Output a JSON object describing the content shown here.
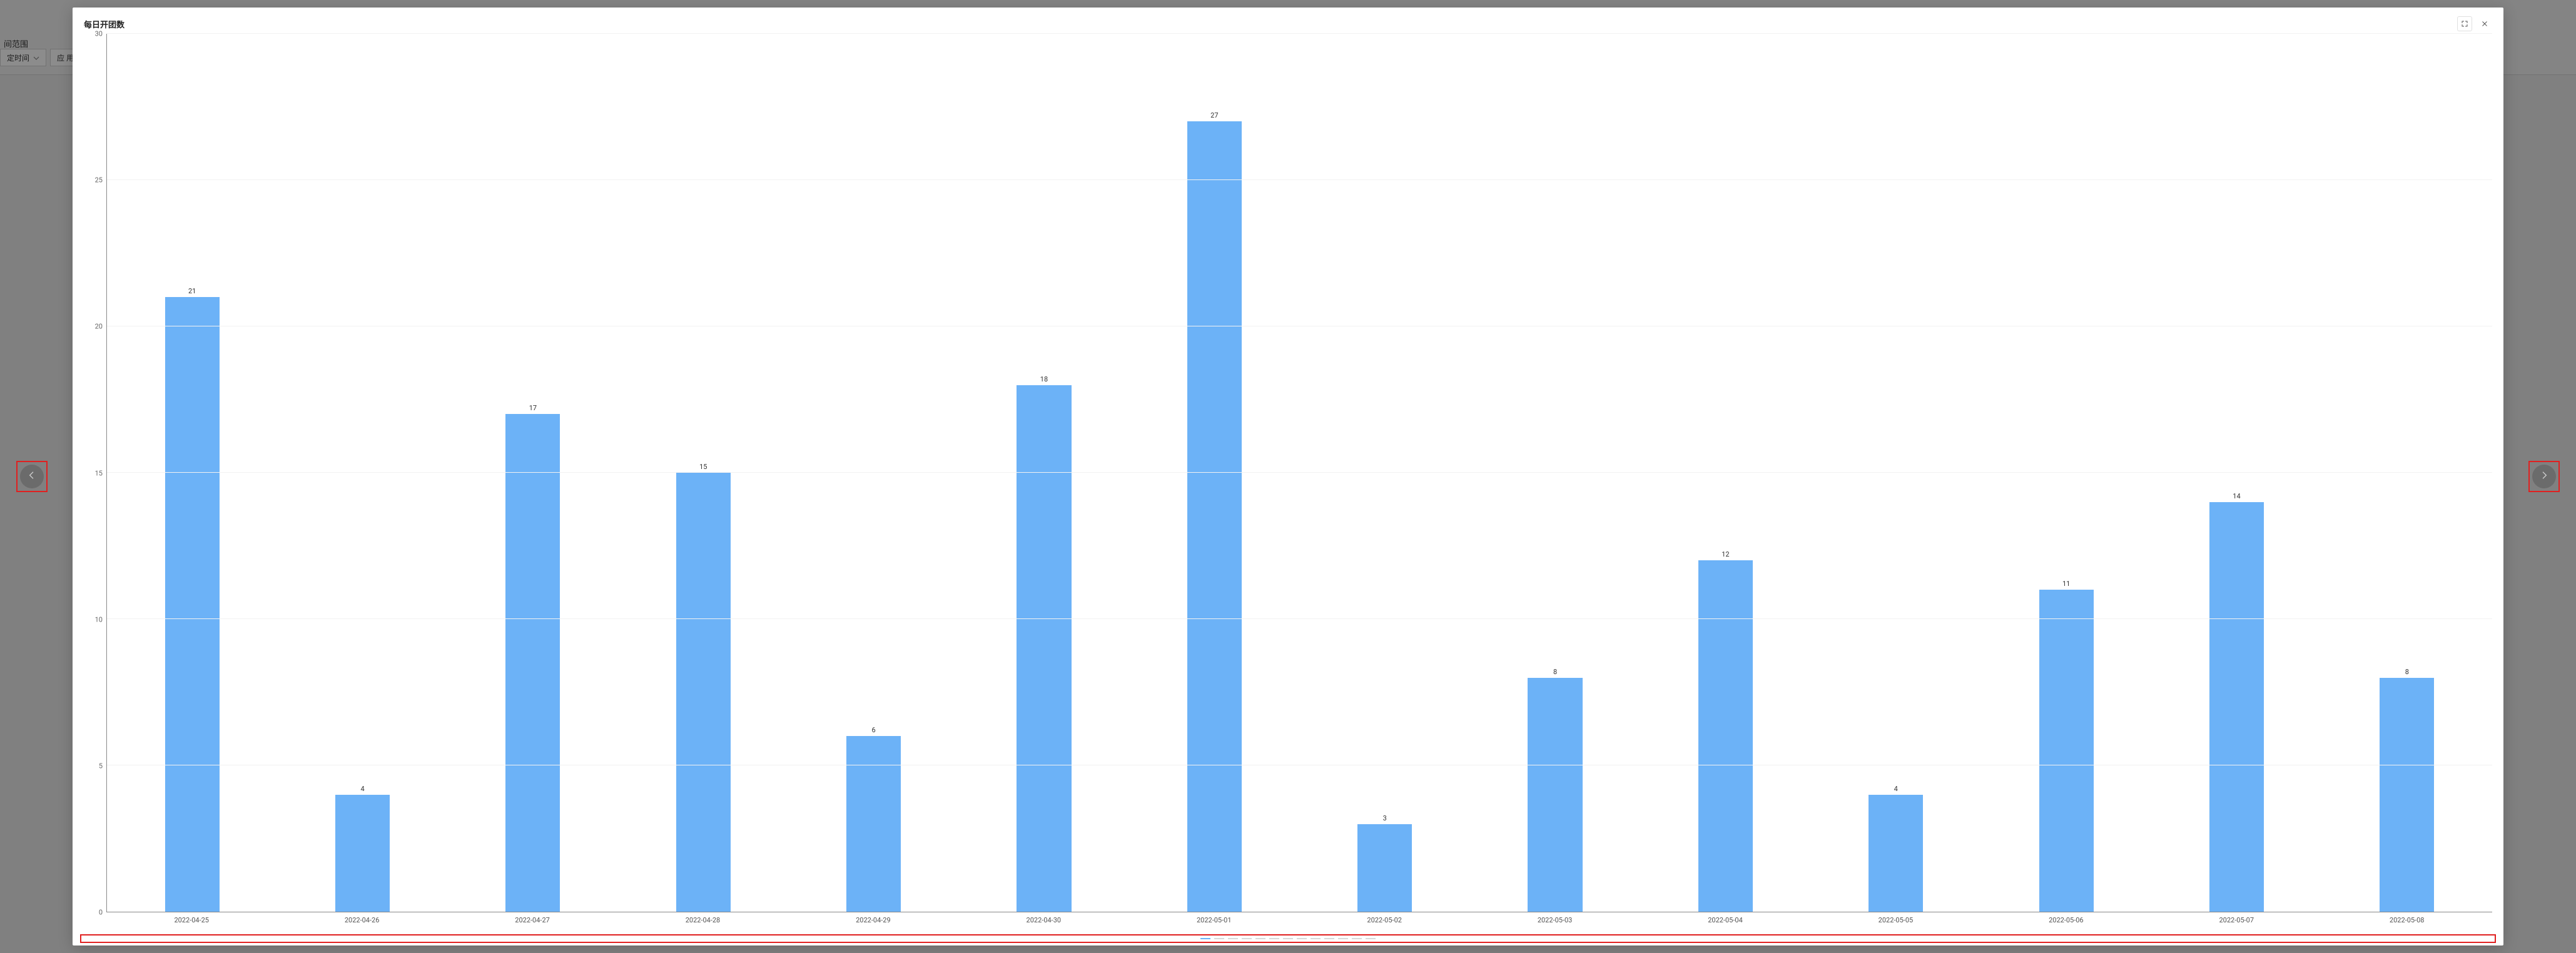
{
  "bg": {
    "range_label": "间范围",
    "select_label": "定时间",
    "apply_label": "应 用"
  },
  "modal": {
    "title": "每日开团数"
  },
  "pagination": {
    "count": 13,
    "active": 0
  },
  "chart_data": {
    "type": "bar",
    "title": "每日开团数",
    "xlabel": "",
    "ylabel": "",
    "ylim": [
      0,
      30
    ],
    "yticks": [
      0,
      5,
      10,
      15,
      20,
      25,
      30
    ],
    "categories": [
      "2022-04-25",
      "2022-04-26",
      "2022-04-27",
      "2022-04-28",
      "2022-04-29",
      "2022-04-30",
      "2022-05-01",
      "2022-05-02",
      "2022-05-03",
      "2022-05-04",
      "2022-05-05",
      "2022-05-06",
      "2022-05-07",
      "2022-05-08"
    ],
    "values": [
      21,
      4,
      17,
      15,
      6,
      18,
      27,
      3,
      8,
      12,
      4,
      11,
      14,
      8
    ],
    "bar_color": "#6cb2f7"
  }
}
